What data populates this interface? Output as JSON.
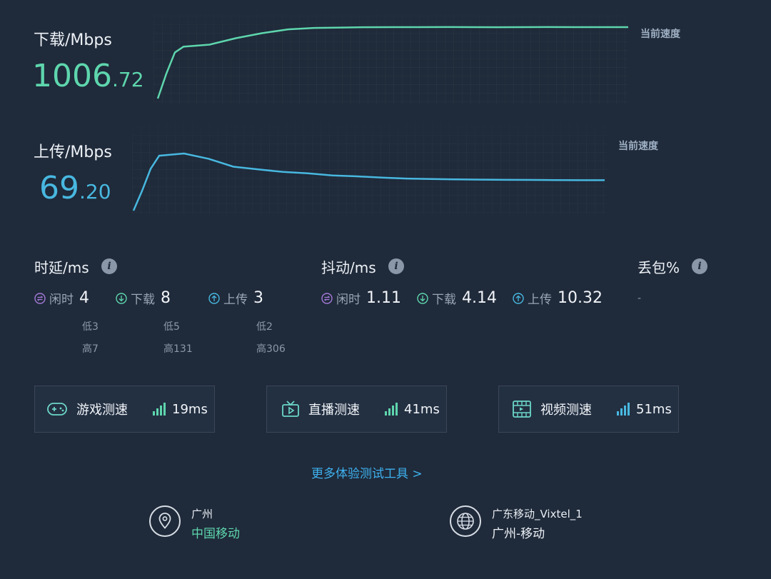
{
  "download": {
    "label": "下载/Mbps",
    "value_int": "1006",
    "value_dec": ".72",
    "current_label": "当前速度",
    "color": "#5ed6ad",
    "curve_mbps": [
      0,
      350,
      650,
      730,
      760,
      850,
      920,
      975,
      995,
      1000,
      1005,
      1006,
      1006,
      1007,
      1006,
      1005,
      1006,
      1007,
      1006,
      1006,
      1006
    ]
  },
  "upload": {
    "label": "上传/Mbps",
    "value_int": "69",
    "value_dec": ".20",
    "current_label": "当前速度",
    "color": "#48b8e0",
    "curve_mbps": [
      0,
      45,
      95,
      125,
      130,
      118,
      100,
      94,
      88,
      85,
      80,
      78,
      75,
      73,
      72,
      71,
      70.5,
      70,
      69.8,
      69.5,
      69.3,
      69.2
    ]
  },
  "latency": {
    "label": "时延/ms",
    "idle": {
      "label": "闲时",
      "value": "4",
      "low": "低3",
      "high": "高7"
    },
    "down": {
      "label": "下载",
      "value": "8",
      "low": "低5",
      "high": "高131"
    },
    "up": {
      "label": "上传",
      "value": "3",
      "low": "低2",
      "high": "高306"
    }
  },
  "jitter": {
    "label": "抖动/ms",
    "idle": {
      "label": "闲时",
      "value": "1.11"
    },
    "down": {
      "label": "下载",
      "value": "4.14"
    },
    "up": {
      "label": "上传",
      "value": "10.32"
    }
  },
  "packet_loss": {
    "label": "丢包%",
    "value": "-"
  },
  "cards": [
    {
      "title": "游戏测速",
      "ms": "19ms",
      "icon": "gamepad-icon"
    },
    {
      "title": "直播测速",
      "ms": "41ms",
      "icon": "tv-icon"
    },
    {
      "title": "视频测速",
      "ms": "51ms",
      "icon": "film-icon"
    }
  ],
  "more_link": "更多体验测试工具 >",
  "client": {
    "city": "广州",
    "isp": "中国移动",
    "isp_color": "#5ed6ad"
  },
  "server": {
    "name": "广东移动_Vixtel_1",
    "location": "广州-移动"
  }
}
